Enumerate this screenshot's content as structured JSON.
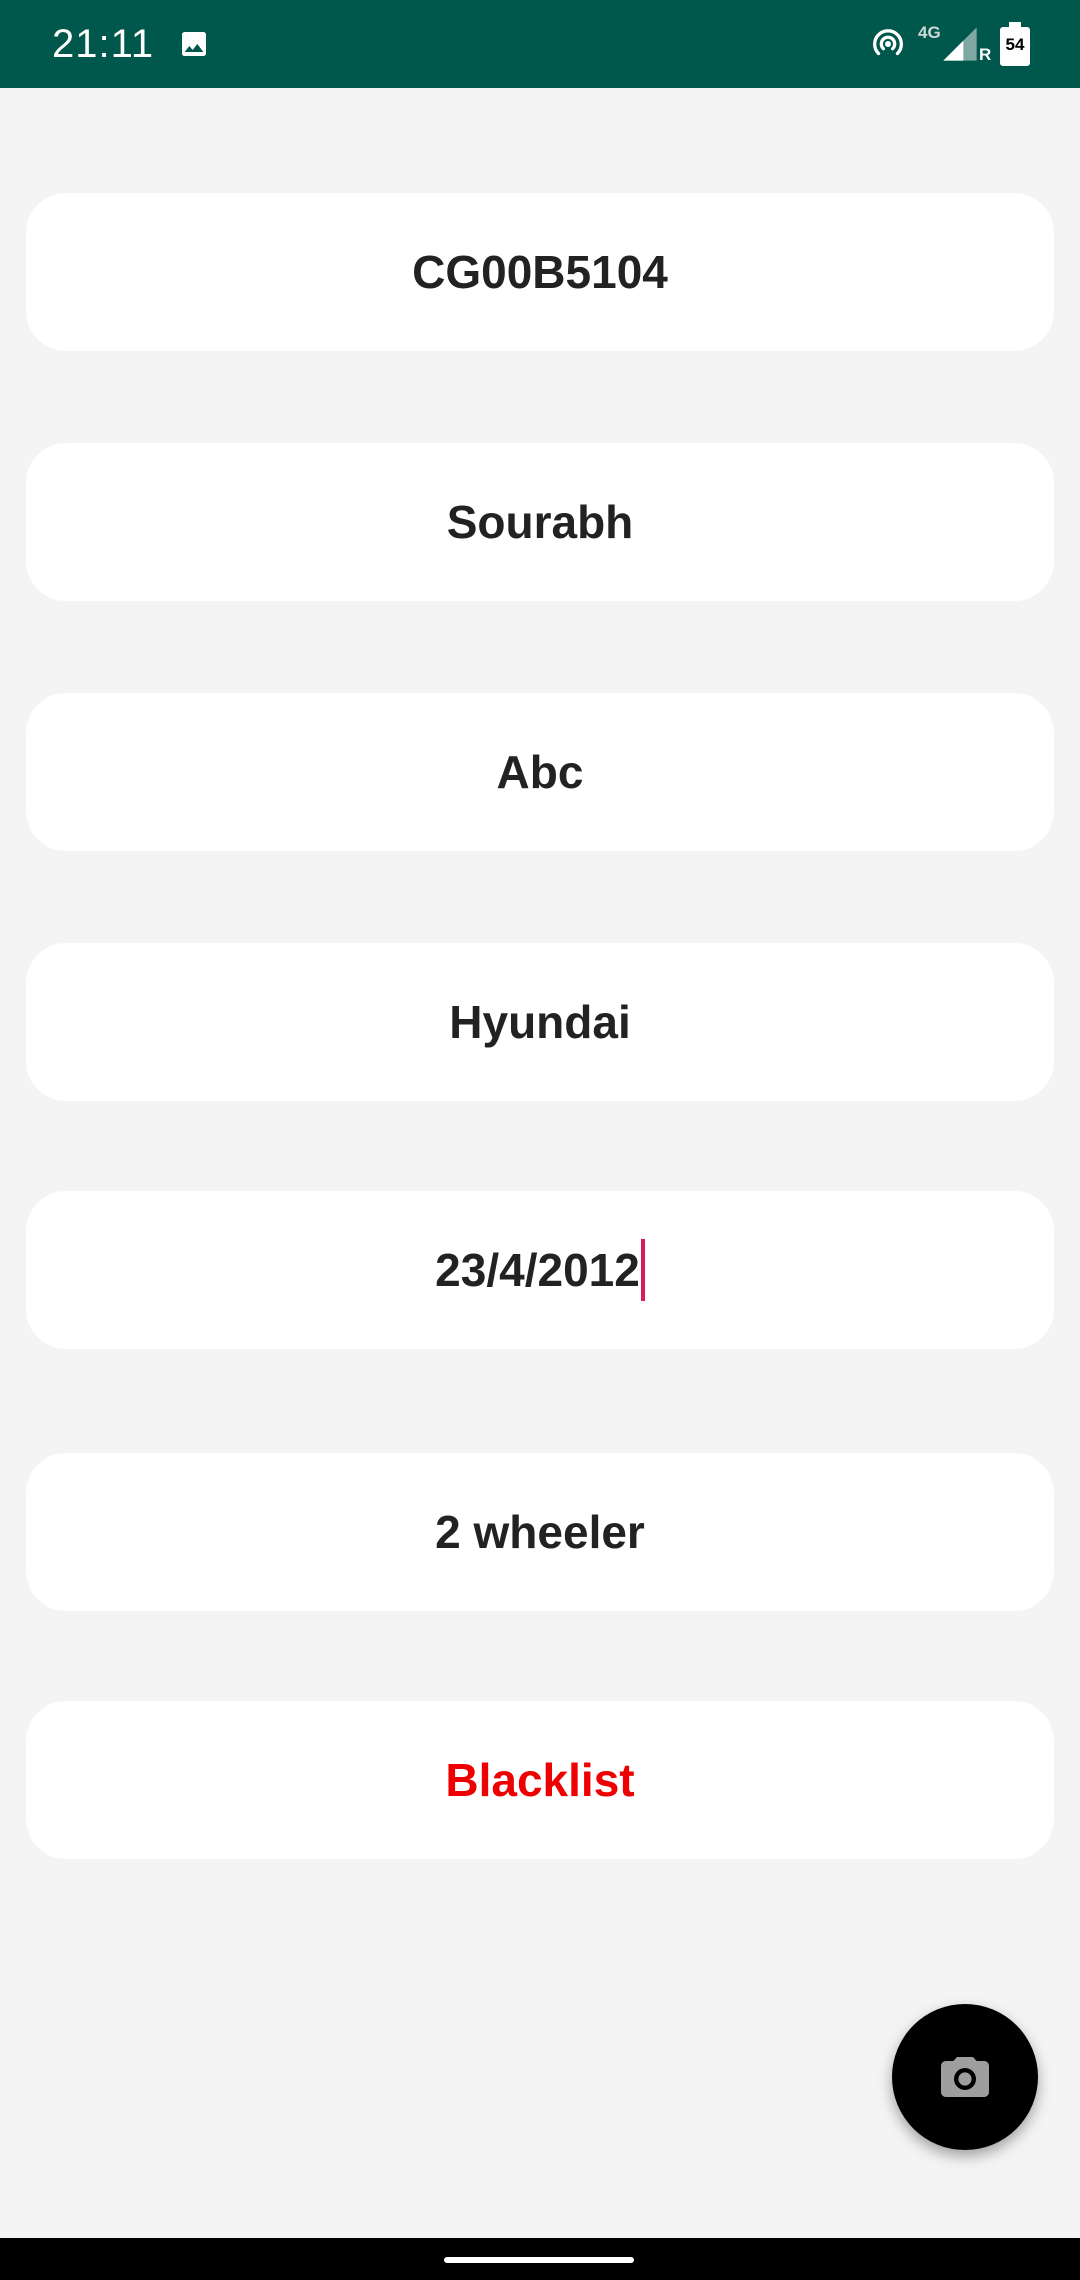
{
  "status_bar": {
    "time": "21:11",
    "network": "4G",
    "roaming": "R",
    "battery": "54",
    "icons": [
      "gallery-icon",
      "hotspot-icon",
      "signal-icon",
      "battery-icon"
    ]
  },
  "fields": {
    "vehicle_number": "CG00B5104",
    "owner_name": "Sourabh",
    "field_3": "Abc",
    "brand": "Hyundai",
    "date": "23/4/2012",
    "vehicle_type": "2 wheeler",
    "blacklist": "Blacklist"
  },
  "fab": {
    "icon": "camera-icon"
  },
  "colors": {
    "status_bar": "#00574b",
    "background": "#f4f4f4",
    "card": "#ffffff",
    "text": "#222222",
    "danger": "#ee0000",
    "cursor": "#d81b60",
    "fab": "#000000"
  }
}
